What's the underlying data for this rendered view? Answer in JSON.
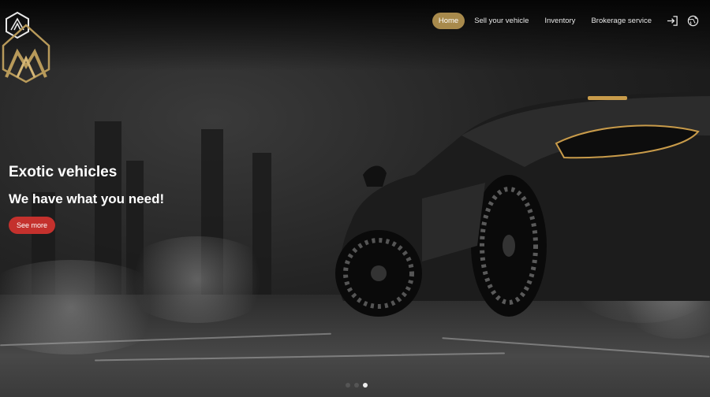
{
  "nav": {
    "items": [
      {
        "label": "Home",
        "active": true
      },
      {
        "label": "Sell your vehicle",
        "active": false
      },
      {
        "label": "Inventory",
        "active": false
      },
      {
        "label": "Brokerage service",
        "active": false
      }
    ],
    "login_icon": "sign-in-icon",
    "language_icon": "globe-icon"
  },
  "brand": {
    "logo_icon": "diamond-monogram-logo-icon",
    "color": "#b89a5a"
  },
  "hero": {
    "headline": "Exotic vehicles",
    "subheadline": "We have what you need!",
    "cta_label": "See more",
    "cta_color": "#c4312d"
  },
  "carousel": {
    "slide_count": 3,
    "active_index": 2
  }
}
